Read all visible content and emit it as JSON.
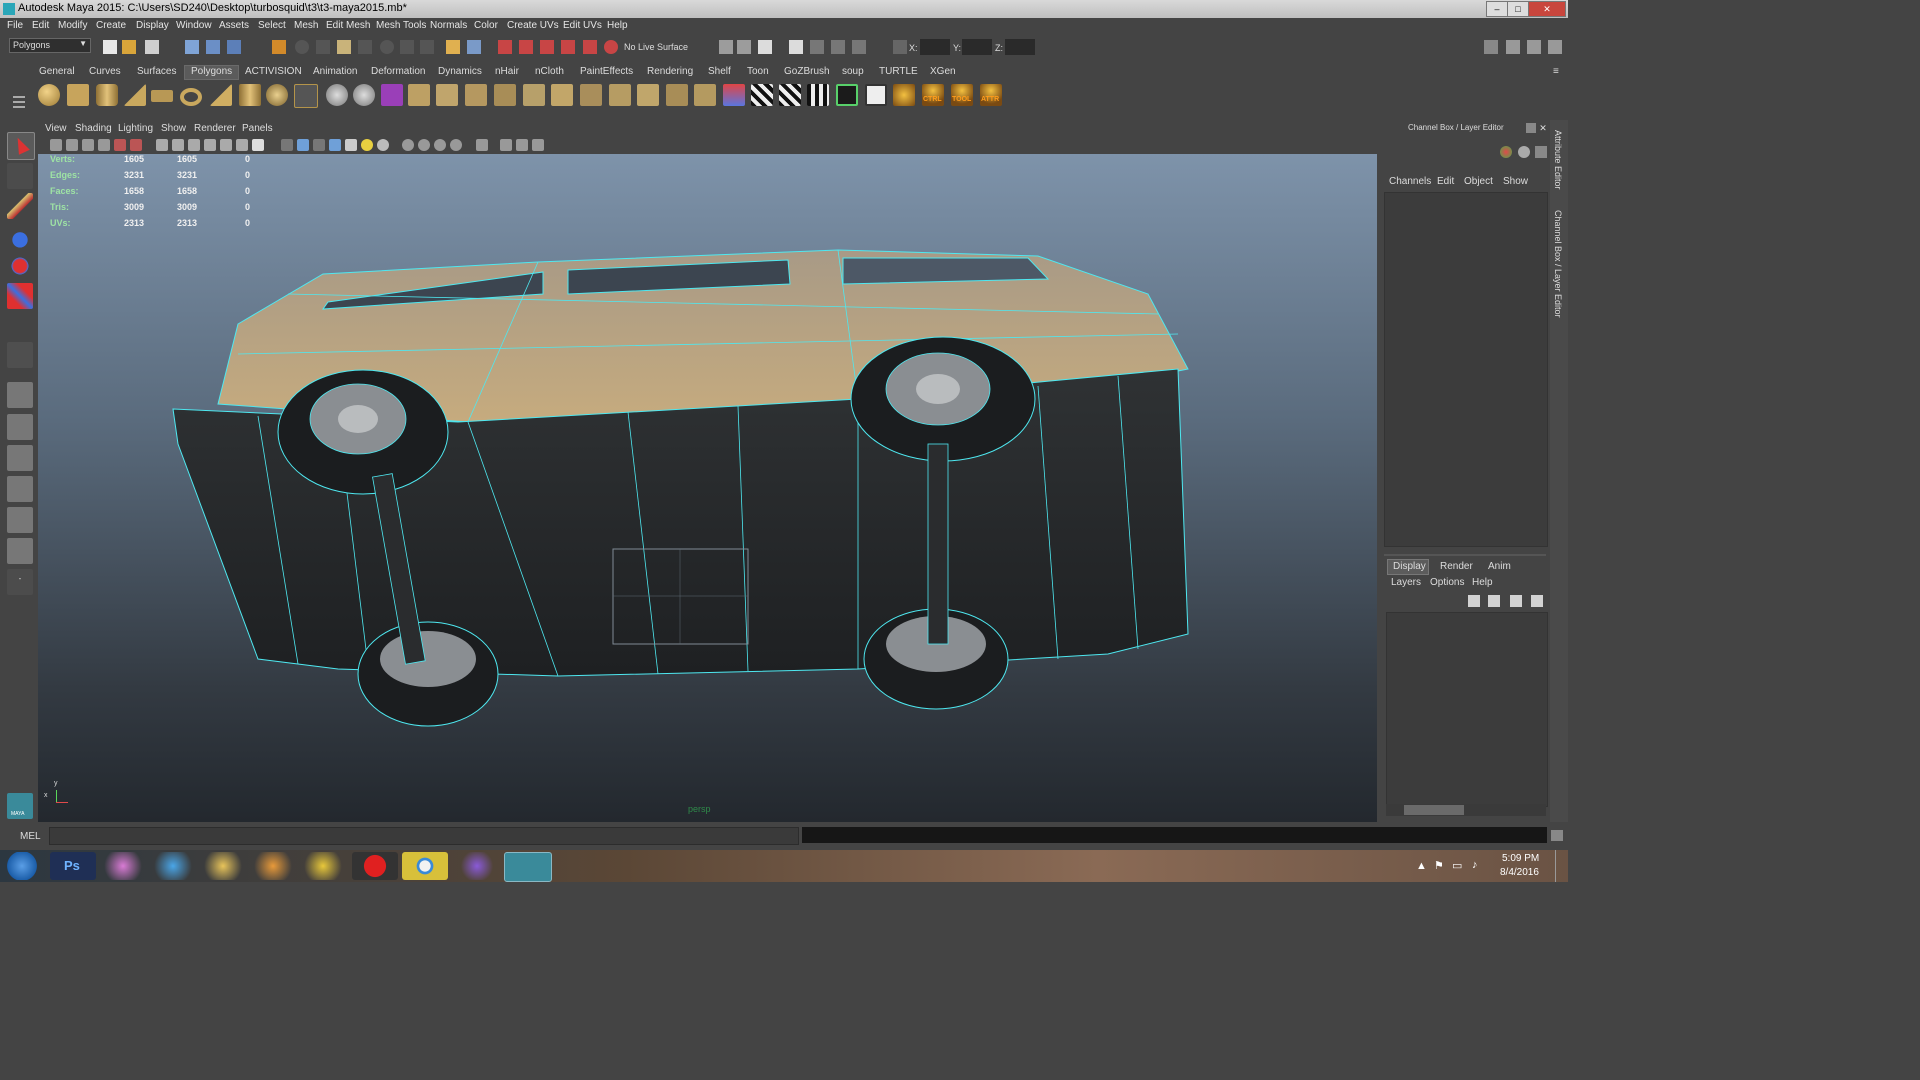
{
  "window": {
    "title": "Autodesk Maya 2015: C:\\Users\\SD240\\Desktop\\turbosquid\\t3\\t3-maya2015.mb*"
  },
  "menubar": [
    "File",
    "Edit",
    "Modify",
    "Create",
    "Display",
    "Window",
    "Assets",
    "Select",
    "Mesh",
    "Edit Mesh",
    "Mesh Tools",
    "Normals",
    "Color",
    "Create UVs",
    "Edit UVs",
    "Help"
  ],
  "statusline": {
    "mode": "Polygons",
    "live_surface": "No Live Surface",
    "x_label": "X:",
    "y_label": "Y:",
    "z_label": "Z:"
  },
  "shelf_tabs": [
    "General",
    "Curves",
    "Surfaces",
    "Polygons",
    "ACTIVISION",
    "Animation",
    "Deformation",
    "Dynamics",
    "nHair",
    "nCloth",
    "PaintEffects",
    "Rendering",
    "Shelf",
    "Toon",
    "GoZBrush",
    "soup",
    "TURTLE",
    "XGen"
  ],
  "shelf_active": "Polygons",
  "shelf_labels": {
    "ctrl": "CTRL",
    "tool": "TOOL",
    "attr": "ATTR"
  },
  "viewport": {
    "menus": [
      "View",
      "Shading",
      "Lighting",
      "Show",
      "Renderer",
      "Panels"
    ],
    "camera": "persp",
    "hud": [
      {
        "label": "Verts:",
        "a": "1605",
        "b": "1605",
        "c": "0"
      },
      {
        "label": "Edges:",
        "a": "3231",
        "b": "3231",
        "c": "0"
      },
      {
        "label": "Faces:",
        "a": "1658",
        "b": "1658",
        "c": "0"
      },
      {
        "label": "Tris:",
        "a": "3009",
        "b": "3009",
        "c": "0"
      },
      {
        "label": "UVs:",
        "a": "2313",
        "b": "2313",
        "c": "0"
      }
    ],
    "axis_x": "x",
    "axis_y": "y"
  },
  "channelbox": {
    "title": "Channel Box / Layer Editor",
    "menus": [
      "Channels",
      "Edit",
      "Object",
      "Show"
    ]
  },
  "layer_editor": {
    "tabs": [
      "Display",
      "Render",
      "Anim"
    ],
    "active_tab": "Display",
    "menus": [
      "Layers",
      "Options",
      "Help"
    ]
  },
  "side_tabs": [
    "Attribute Editor",
    "Channel Box / Layer Editor"
  ],
  "cmdline": {
    "label": "MEL"
  },
  "toolbox": {
    "maya_label": "MAYA"
  },
  "taskbar": {
    "time": "5:09 PM",
    "date": "8/4/2016",
    "apps": [
      "start",
      "photoshop",
      "paint",
      "ie",
      "explorer",
      "media",
      "tool",
      "opera",
      "chrome",
      "viber",
      "maya"
    ],
    "ps_label": "Ps"
  },
  "colors": {
    "wire": "#4ee8f0",
    "body_tan": "#c4a77c",
    "body_dark": "#2a2c2e",
    "hud_label": "#9ee3a4"
  }
}
